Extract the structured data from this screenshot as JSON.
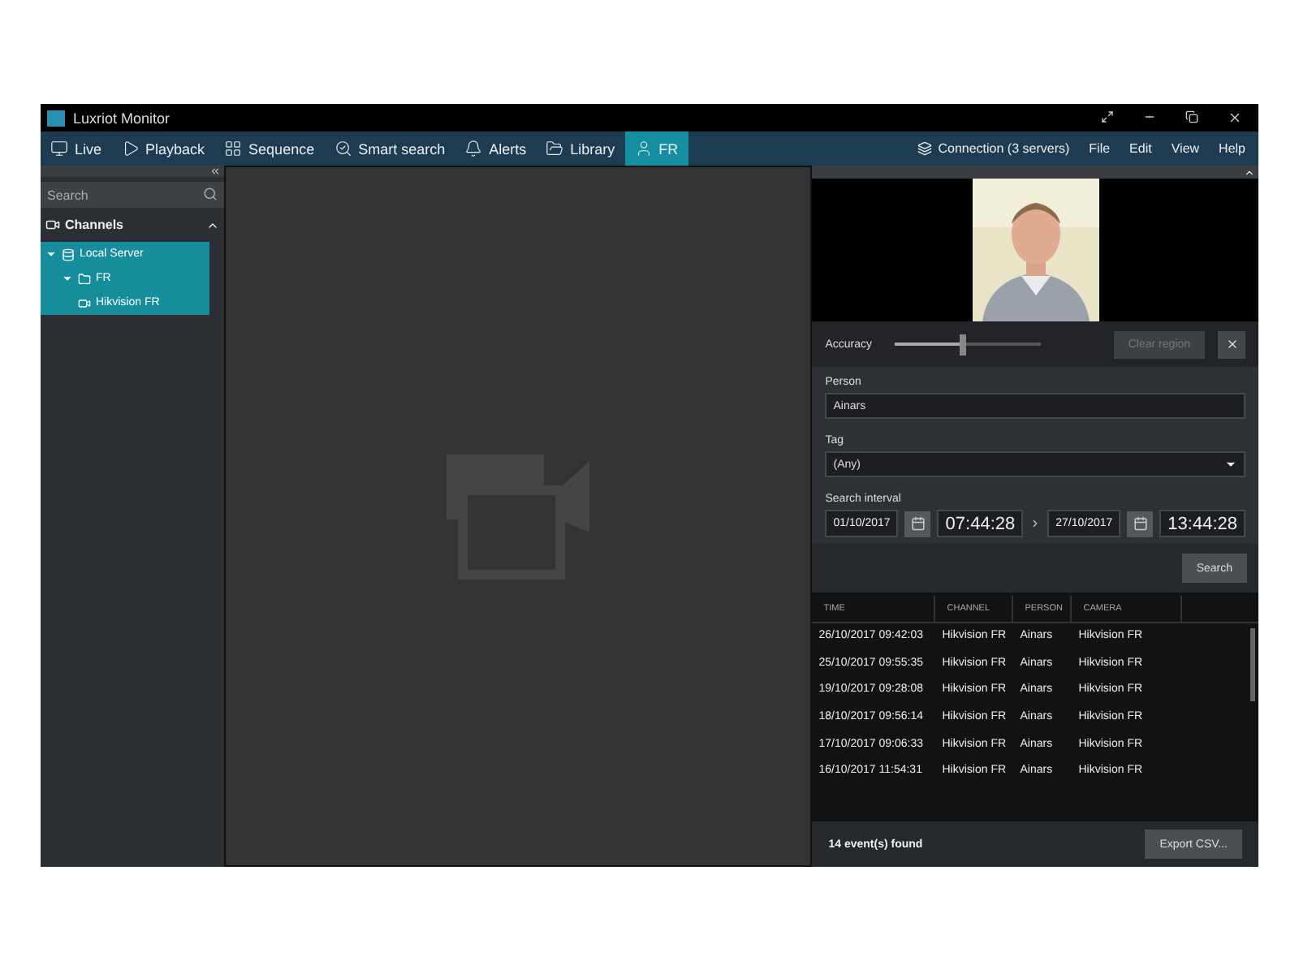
{
  "window": {
    "title": "Luxriot Monitor"
  },
  "nav_tabs": [
    {
      "label": "Live",
      "selected": false
    },
    {
      "label": "Playback",
      "selected": false
    },
    {
      "label": "Sequence",
      "selected": false
    },
    {
      "label": "Smart search",
      "selected": false
    },
    {
      "label": "Alerts",
      "selected": false
    },
    {
      "label": "Library",
      "selected": false
    },
    {
      "label": "FR",
      "selected": true
    }
  ],
  "connection": "Connection (3 servers)",
  "menu": [
    "File",
    "Edit",
    "View",
    "Help"
  ],
  "sidebar": {
    "search": {
      "placeholder": "Search"
    },
    "section": "Channels",
    "expanded": true,
    "tree": [
      {
        "kind": "server",
        "label": "Local Server",
        "expanded": true,
        "selected": true,
        "children": [
          {
            "kind": "folder",
            "label": "FR",
            "expanded": true,
            "selected": true,
            "children": [
              {
                "kind": "camera",
                "label": "Hikvision FR",
                "selected": true
              }
            ]
          }
        ]
      }
    ]
  },
  "fr_panel": {
    "accuracy": {
      "label": "Accuracy",
      "level": 0.45
    },
    "clear_region": {
      "label": "Clear region",
      "disabled": true
    },
    "person": {
      "label": "Person",
      "value": "Ainars"
    },
    "tag": {
      "label": "Tag",
      "value": "(Any)"
    },
    "interval": {
      "label": "Search interval",
      "from_date": "01/10/2017",
      "from_time": "07:44:28",
      "to_date": "27/10/2017",
      "to_time": "13:44:28"
    },
    "search_button": "Search",
    "table": {
      "columns": [
        "TIME",
        "CHANNEL",
        "PERSON",
        "CAMERA"
      ],
      "rows": [
        [
          "26/10/2017 09:42:03",
          "Hikvision FR",
          "Ainars",
          "Hikvision FR"
        ],
        [
          "25/10/2017 09:55:35",
          "Hikvision FR",
          "Ainars",
          "Hikvision FR"
        ],
        [
          "19/10/2017 09:28:08",
          "Hikvision FR",
          "Ainars",
          "Hikvision FR"
        ],
        [
          "18/10/2017 09:56:14",
          "Hikvision FR",
          "Ainars",
          "Hikvision FR"
        ],
        [
          "17/10/2017 09:06:33",
          "Hikvision FR",
          "Ainars",
          "Hikvision FR"
        ],
        [
          "16/10/2017 11:54:31",
          "Hikvision FR",
          "Ainars",
          "Hikvision FR"
        ]
      ]
    },
    "found": "14 event(s) found",
    "export_button": "Export CSV..."
  }
}
